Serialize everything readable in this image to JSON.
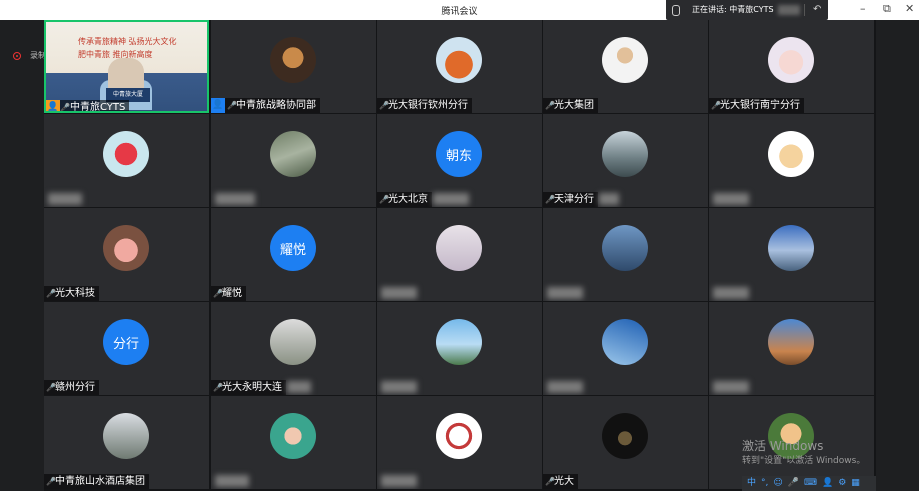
{
  "window": {
    "title": "腾讯会议",
    "speaking_prefix": "正在讲话:",
    "speaking_name": "中青旅CYTS",
    "minimize": "–",
    "restore": "⧉",
    "close": "✕",
    "back_icon": "↶"
  },
  "recording": {
    "label": "录制中",
    "color": "#e33333"
  },
  "tiles": [
    {
      "kind": "video",
      "name": "中青旅CYTS",
      "banner1": "传承青旅精神  弘扬光大文化",
      "banner2": "肥中青旅    推向新高度",
      "podium": "中青旅大厦"
    },
    {
      "kind": "avatar",
      "art": "av-dog",
      "name": "中青旅战略协同部",
      "host_icon": true
    },
    {
      "kind": "avatar",
      "art": "av-orange",
      "name": "光大银行钦州分行",
      "mic": false
    },
    {
      "kind": "avatar",
      "art": "av-man",
      "name": "光大集团"
    },
    {
      "kind": "avatar",
      "art": "av-baby",
      "name": "光大银行南宁分行"
    },
    {
      "kind": "avatar",
      "art": "av-heart",
      "name": "",
      "blur_w": 34
    },
    {
      "kind": "avatar",
      "art": "av-road",
      "name": "",
      "blur_w": 40
    },
    {
      "kind": "text",
      "initials": "朝东",
      "name": "光大北京",
      "blur_w": 36
    },
    {
      "kind": "avatar",
      "art": "av-street",
      "name": "天津分行",
      "blur_w": 20
    },
    {
      "kind": "avatar",
      "art": "av-cartoon",
      "name": "",
      "blur_w": 36
    },
    {
      "kind": "avatar",
      "art": "av-pig",
      "name": "光大科技"
    },
    {
      "kind": "text",
      "initials": "耀悦",
      "name": "耀悦"
    },
    {
      "kind": "avatar",
      "art": "av-dance",
      "name": "",
      "blur_w": 36
    },
    {
      "kind": "avatar",
      "art": "av-mask",
      "name": "",
      "blur_w": 36
    },
    {
      "kind": "avatar",
      "art": "av-lake",
      "name": "",
      "blur_w": 36
    },
    {
      "kind": "text",
      "initials": "分行",
      "name": "赣州分行"
    },
    {
      "kind": "avatar",
      "art": "av-branch",
      "name": "光大永明大连",
      "blur_w": 24
    },
    {
      "kind": "avatar",
      "art": "av-island",
      "name": "",
      "blur_w": 36
    },
    {
      "kind": "avatar",
      "art": "av-wave",
      "name": "",
      "blur_w": 36
    },
    {
      "kind": "avatar",
      "art": "av-tower",
      "name": "",
      "blur_w": 36
    },
    {
      "kind": "avatar",
      "art": "av-winter",
      "name": "中青旅山水酒店集团"
    },
    {
      "kind": "avatar",
      "art": "av-green",
      "name": "",
      "blur_w": 34
    },
    {
      "kind": "avatar",
      "art": "av-sketch",
      "name": "",
      "blur_w": 36
    },
    {
      "kind": "avatar",
      "art": "av-dark",
      "name": "光大"
    },
    {
      "kind": "avatar",
      "art": "av-glasses",
      "name": "",
      "blur_w": 0
    }
  ],
  "watermark": {
    "line1": "激活 Windows",
    "line2": "转到\"设置\"以激活 Windows。"
  },
  "tray": [
    "中",
    "°,",
    "☺",
    "🎤",
    "⌨",
    "👤",
    "⚙",
    "▦"
  ]
}
